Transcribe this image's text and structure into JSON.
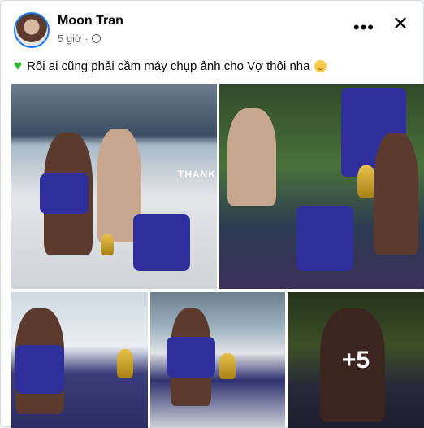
{
  "post": {
    "author": "Moon Tran",
    "time": "5 giờ",
    "privacy_icon": "globe-icon",
    "more_icon": "more-options-icon",
    "close_icon": "close-icon",
    "caption": "Rồi ai cũng phải cầm máy chụp ảnh cho Vợ thôi nha",
    "caption_leading_emoji": "green-heart-icon",
    "caption_trailing_emoji": "smiling-face-icon"
  },
  "gallery": {
    "photos": [
      {
        "label": "photo-1",
        "sign_text": "THANK"
      },
      {
        "label": "photo-2"
      },
      {
        "label": "photo-3"
      },
      {
        "label": "photo-4"
      },
      {
        "label": "photo-5"
      }
    ],
    "more_count": "+5"
  },
  "colors": {
    "brand_blue": "#1877f2",
    "text_primary": "#050505",
    "text_secondary": "#65676b",
    "heart_green": "#2eb82e"
  }
}
